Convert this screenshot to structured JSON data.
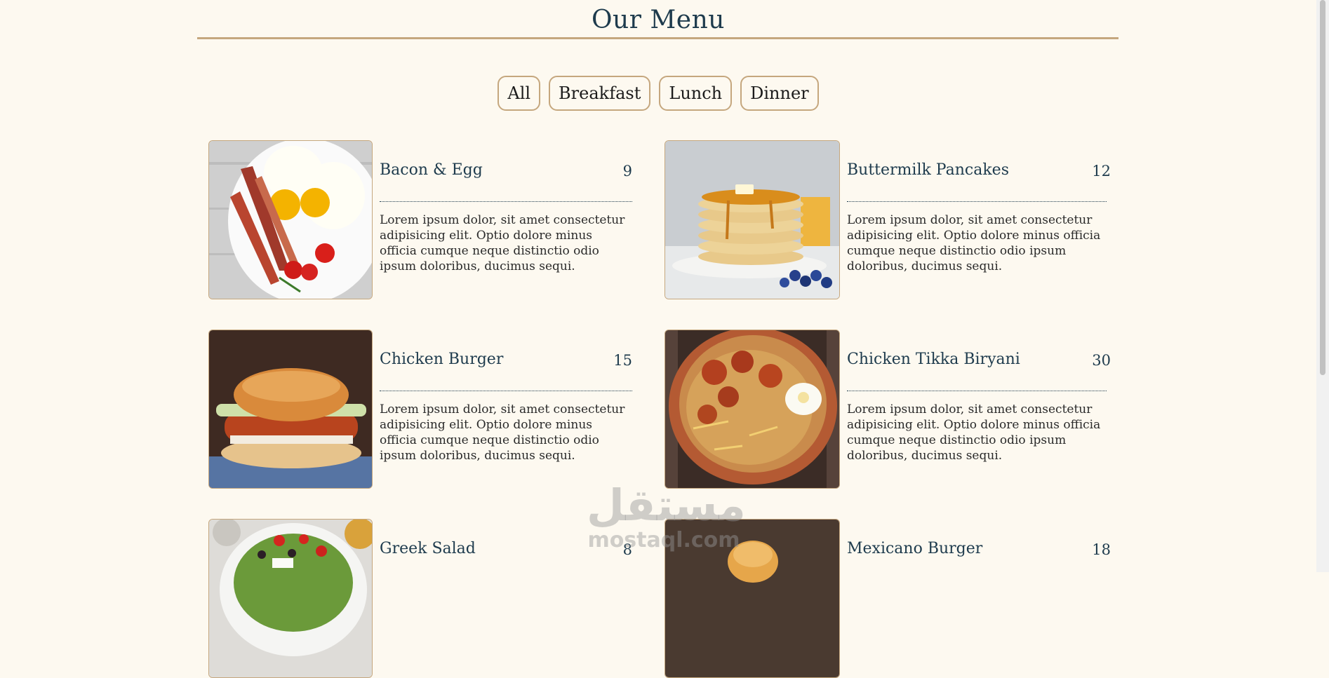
{
  "page": {
    "title": "Our Menu"
  },
  "filters": [
    {
      "label": "All"
    },
    {
      "label": "Breakfast"
    },
    {
      "label": "Lunch"
    },
    {
      "label": "Dinner"
    }
  ],
  "items": [
    {
      "name": "Bacon & Egg",
      "price": "9",
      "description": "Lorem ipsum dolor, sit amet consectetur adipisicing elit. Optio dolore minus officia cumque neque distinctio odio ipsum doloribus, ducimus sequi."
    },
    {
      "name": "Buttermilk Pancakes",
      "price": "12",
      "description": "Lorem ipsum dolor, sit amet consectetur adipisicing elit. Optio dolore minus officia cumque neque distinctio odio ipsum doloribus, ducimus sequi."
    },
    {
      "name": "Chicken Burger",
      "price": "15",
      "description": "Lorem ipsum dolor, sit amet consectetur adipisicing elit. Optio dolore minus officia cumque neque distinctio odio ipsum doloribus, ducimus sequi."
    },
    {
      "name": "Chicken Tikka Biryani",
      "price": "30",
      "description": "Lorem ipsum dolor, sit amet consectetur adipisicing elit. Optio dolore minus officia cumque neque distinctio odio ipsum doloribus, ducimus sequi."
    },
    {
      "name": "Greek Salad",
      "price": "8",
      "description": ""
    },
    {
      "name": "Mexicano Burger",
      "price": "18",
      "description": ""
    }
  ],
  "watermark": {
    "arabic": "مستقل",
    "latin": "mostaql.com"
  },
  "colors": {
    "background": "#fdf9f0",
    "heading": "#1e3b4d",
    "accent": "#c5a77e"
  }
}
